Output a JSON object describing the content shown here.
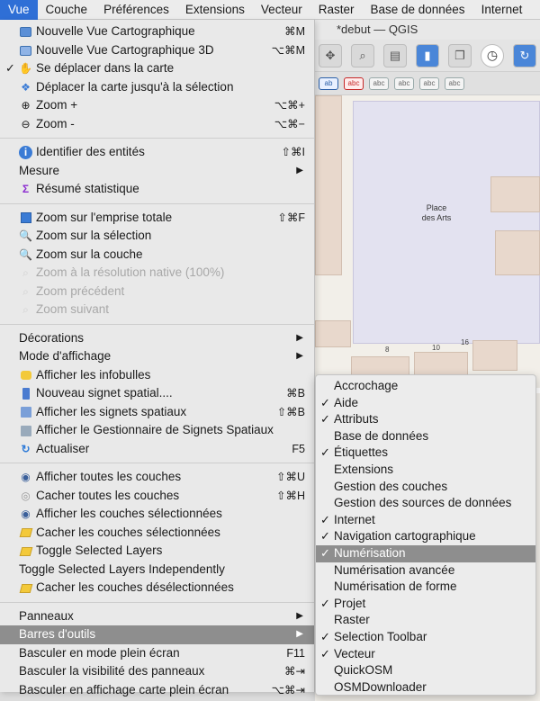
{
  "menubar": {
    "items": [
      "Vue",
      "Couche",
      "Préférences",
      "Extensions",
      "Vecteur",
      "Raster",
      "Base de données",
      "Internet"
    ]
  },
  "window": {
    "title": "*debut — QGIS"
  },
  "toolbar2": {
    "label_buttons": [
      "ab",
      "abc",
      "abc",
      "abc",
      "abc",
      "abc"
    ]
  },
  "map": {
    "place_label_line1": "Place",
    "place_label_line2": "des Arts",
    "numbers": [
      "8",
      "10",
      "16"
    ]
  },
  "menu": {
    "group1": [
      {
        "label": "Nouvelle Vue Cartographique",
        "shortcut": "⌘M"
      },
      {
        "label": "Nouvelle Vue Cartographique 3D",
        "shortcut": "⌥⌘M"
      },
      {
        "label": "Se déplacer dans la carte",
        "checked": "✓"
      },
      {
        "label": "Déplacer la carte jusqu'à la sélection"
      },
      {
        "label": "Zoom +",
        "shortcut": "⌥⌘+"
      },
      {
        "label": "Zoom -",
        "shortcut": "⌥⌘−"
      }
    ],
    "group2": [
      {
        "label": "Identifier des entités",
        "shortcut": "⇧⌘I"
      },
      {
        "label": "Mesure",
        "arrow": "▶"
      },
      {
        "label": "Résumé statistique"
      }
    ],
    "group3": [
      {
        "label": "Zoom sur l'emprise totale",
        "shortcut": "⇧⌘F"
      },
      {
        "label": "Zoom sur la sélection"
      },
      {
        "label": "Zoom sur la couche"
      },
      {
        "label": "Zoom à la résolution native (100%)"
      },
      {
        "label": "Zoom précédent"
      },
      {
        "label": "Zoom suivant"
      }
    ],
    "group4": [
      {
        "label": "Décorations",
        "arrow": "▶"
      },
      {
        "label": "Mode d'affichage",
        "arrow": "▶"
      },
      {
        "label": "Afficher les infobulles"
      },
      {
        "label": "Nouveau signet spatial....",
        "shortcut": "⌘B"
      },
      {
        "label": "Afficher les signets spatiaux",
        "shortcut": "⇧⌘B"
      },
      {
        "label": "Afficher le Gestionnaire de Signets Spatiaux"
      },
      {
        "label": "Actualiser",
        "shortcut": "F5"
      }
    ],
    "group5": [
      {
        "label": "Afficher toutes les couches",
        "shortcut": "⇧⌘U"
      },
      {
        "label": "Cacher toutes les couches",
        "shortcut": "⇧⌘H"
      },
      {
        "label": "Afficher les couches sélectionnées"
      },
      {
        "label": "Cacher les couches sélectionnées"
      },
      {
        "label": "Toggle Selected Layers"
      },
      {
        "label": "Toggle Selected Layers Independently"
      },
      {
        "label": "Cacher les couches désélectionnées"
      }
    ],
    "group6": [
      {
        "label": "Panneaux",
        "arrow": "▶"
      },
      {
        "label": "Barres d'outils",
        "arrow": "▶"
      },
      {
        "label": "Basculer en mode plein écran",
        "shortcut": "F11"
      },
      {
        "label": "Basculer la visibilité des panneaux",
        "shortcut": "⌘⇥"
      },
      {
        "label": "Basculer en affichage carte plein écran",
        "shortcut": "⌥⌘⇥"
      }
    ]
  },
  "submenu": {
    "items": [
      {
        "label": "Accrochage",
        "checked": ""
      },
      {
        "label": "Aide",
        "checked": "✓"
      },
      {
        "label": "Attributs",
        "checked": "✓"
      },
      {
        "label": "Base de données",
        "checked": ""
      },
      {
        "label": "Étiquettes",
        "checked": "✓"
      },
      {
        "label": "Extensions",
        "checked": ""
      },
      {
        "label": "Gestion des couches",
        "checked": ""
      },
      {
        "label": "Gestion des sources de données",
        "checked": ""
      },
      {
        "label": "Internet",
        "checked": "✓"
      },
      {
        "label": "Navigation cartographique",
        "checked": "✓"
      },
      {
        "label": "Numérisation",
        "checked": "✓"
      },
      {
        "label": "Numérisation avancée",
        "checked": ""
      },
      {
        "label": "Numérisation de forme",
        "checked": ""
      },
      {
        "label": "Projet",
        "checked": "✓"
      },
      {
        "label": "Raster",
        "checked": ""
      },
      {
        "label": "Selection Toolbar",
        "checked": "✓"
      },
      {
        "label": "Vecteur",
        "checked": "✓"
      },
      {
        "label": "QuickOSM",
        "checked": ""
      },
      {
        "label": "OSMDownloader",
        "checked": ""
      }
    ]
  }
}
